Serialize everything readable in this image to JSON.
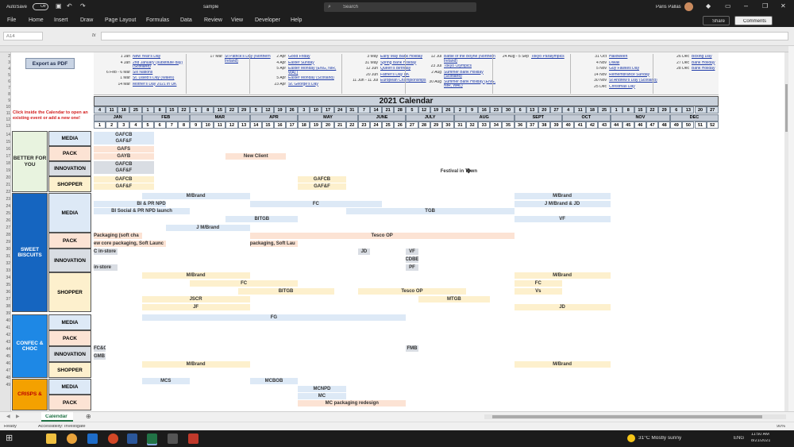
{
  "titlebar": {
    "autosave": "AutoSave",
    "autosave_state": "Off",
    "filename": "sample",
    "search": "Search",
    "user": "Paris Pallas"
  },
  "ribbon": {
    "tabs": [
      "File",
      "Home",
      "Insert",
      "Draw",
      "Page Layout",
      "Formulas",
      "Data",
      "Review",
      "View",
      "Developer",
      "Help"
    ],
    "share": "Share",
    "comments": "Comments"
  },
  "formula_bar": {
    "name_box": "A14",
    "fx": "fx"
  },
  "export_button": "Export as PDF",
  "instruction": "Click inside the Calendar to open an existing event or add a new one!",
  "holidays": {
    "col1": [
      [
        "1 Jan",
        "New Year's Day"
      ],
      [
        "4 Jan",
        "2nd January (substitute day) (Scotland)"
      ],
      [
        "6 Feb - 6 Mar",
        "Six Nations"
      ],
      [
        "1 Mar",
        "St. David's Day (Wales)"
      ],
      [
        "14 Mar",
        "Mother's Day 2021 in UK"
      ]
    ],
    "col2": [
      [
        "17 Mar",
        "St Patrick's Day (Northern Ireland)"
      ]
    ],
    "col3": [
      [
        "2 Apr",
        "Good Friday"
      ],
      [
        "4 Apr",
        "Easter Sunday"
      ],
      [
        "5 Apr",
        "Easter Monday (ENG, NIR, WAL)"
      ],
      [
        "5 Apr",
        "Easter Monday (Scotland)"
      ],
      [
        "23 Apr",
        "St. George's Day"
      ]
    ],
    "col4": [
      [
        "3 May",
        "Early May Bank Holiday"
      ],
      [
        "31 May",
        "Spring Bank Holiday"
      ],
      [
        "12 Jun",
        "Queen's Birthday"
      ],
      [
        "20 Jun",
        "Father's Day UK"
      ],
      [
        "11 Jun - 11 Jul",
        "European Championships"
      ]
    ],
    "col5": [
      [
        "12 Jul",
        "Battle of the Boyne (Northern Ireland)"
      ],
      [
        "23 Jul",
        "Tokyo Olympics"
      ],
      [
        "2 Aug",
        "Summer Bank Holiday (Scotland)"
      ],
      [
        "30 Aug",
        "Summer Bank Holiday (ENG, NIR, WAL)"
      ]
    ],
    "col6": [
      [
        "24 Aug - 5 Sep",
        "Tokyo Paralympics"
      ]
    ],
    "col7": [
      [
        "31 Oct",
        "Halloween"
      ],
      [
        "4 Nov",
        "Diwali"
      ],
      [
        "5 Nov",
        "Guy Fawkes Day"
      ],
      [
        "14 Nov",
        "Remembrance Sunday"
      ],
      [
        "30 Nov",
        "St Andrew's Day (Scotland)"
      ],
      [
        "25 Dec",
        "Christmas Day"
      ]
    ],
    "col8": [
      [
        "26 Dec",
        "Boxing Day"
      ],
      [
        "27 Dec",
        "Bank Holiday"
      ],
      [
        "28 Dec",
        "Bank Holiday"
      ]
    ]
  },
  "calendar": {
    "title": "2021 Calendar",
    "week_days": [
      "4",
      "11",
      "18",
      "25",
      "1",
      "8",
      "15",
      "22",
      "1",
      "8",
      "15",
      "22",
      "29",
      "5",
      "12",
      "19",
      "26",
      "3",
      "10",
      "17",
      "24",
      "31",
      "7",
      "14",
      "21",
      "28",
      "5",
      "12",
      "19",
      "26",
      "2",
      "9",
      "16",
      "23",
      "30",
      "6",
      "13",
      "20",
      "27",
      "4",
      "11",
      "18",
      "25",
      "1",
      "8",
      "15",
      "22",
      "29",
      "6",
      "13",
      "20",
      "27"
    ],
    "months": [
      [
        "JAN",
        4
      ],
      [
        "FEB",
        4
      ],
      [
        "MAR",
        5
      ],
      [
        "APR",
        4
      ],
      [
        "MAY",
        5
      ],
      [
        "JUNE",
        4
      ],
      [
        "JULY",
        4
      ],
      [
        "AUG",
        5
      ],
      [
        "SEPT",
        4
      ],
      [
        "OCT",
        4
      ],
      [
        "NOV",
        5
      ],
      [
        "DEC",
        4
      ]
    ],
    "week_numbers": [
      "1",
      "2",
      "3",
      "4",
      "5",
      "6",
      "7",
      "8",
      "9",
      "10",
      "11",
      "12",
      "13",
      "14",
      "15",
      "16",
      "17",
      "18",
      "19",
      "20",
      "21",
      "22",
      "23",
      "24",
      "25",
      "26",
      "27",
      "28",
      "29",
      "30",
      "31",
      "32",
      "33",
      "34",
      "35",
      "36",
      "37",
      "38",
      "39",
      "40",
      "41",
      "42",
      "43",
      "44",
      "45",
      "46",
      "47",
      "48",
      "49",
      "50",
      "51",
      "52"
    ]
  },
  "categories": [
    {
      "name": "BETTER FOR YOU",
      "color": "#e8f3df",
      "subs": [
        "MEDIA",
        "PACK",
        "INNOVATION",
        "SHOPPER"
      ]
    },
    {
      "name": "SWEET BISCUITS",
      "color": "#1565c0",
      "subs": [
        "MEDIA",
        "PACK",
        "INNOVATION",
        "SHOPPER"
      ]
    },
    {
      "name": "CONFEC & CHOC",
      "color": "#1e88e5",
      "subs": [
        "MEDIA",
        "PACK",
        "INNOVATION",
        "SHOPPER"
      ]
    },
    {
      "name": "CRISPS &",
      "color": "#f4a100",
      "subs": [
        "MEDIA",
        "PACK"
      ]
    }
  ],
  "events": {
    "gafcb1": "GAFCB",
    "gaff1": "GAF&F",
    "gafs": "GAFS",
    "gayb": "GAYB",
    "gafcb2": "GAFCB",
    "gaff2": "GAF&F",
    "gafcb3": "GAFCB",
    "gaff3": "GAF&F",
    "newclient": "New Client",
    "gafcb4": "GAFCB",
    "gaff4": "GAF&F",
    "festival": "Festival in Town",
    "mbrand1": "M/Brand",
    "prnpd": "BI & PR NPD",
    "fc1": "FC",
    "bisocial": "BI Social & PR NPD launch",
    "tgb": "TGB",
    "bitgb1": "BITGB",
    "mbrand2": "M/Brand",
    "mbrandjd": "J M/Brand & JD",
    "vf1": "VF",
    "jmbrand": "J M/Brand",
    "pack1": "Packaging (soft cha",
    "pack2": "ew core packaging, Soft Launc",
    "pack3": "packaging, Soft Lau",
    "tescoop1": "Tesco OP",
    "instore1": "C in-store",
    "jd1": "JD",
    "vf2": "VF",
    "cdbe": "CDBE",
    "instore2": "in-store",
    "pf": "PF",
    "mbrand3": "M/Brand",
    "mbrand4": "M/Brand",
    "fc2": "FC",
    "fc3": "FC",
    "bitgb2": "BITGB",
    "tescoop2": "Tesco OP",
    "vs": "Vs",
    "jscr": "JSCR",
    "mtgb": "MTGB",
    "jf": "JF",
    "jd2": "JD",
    "fg": "FG",
    "fcc": "FC&C",
    "gmb": "GMB",
    "fmb": "FMB",
    "mbrand5": "M/Brand",
    "mbrand6": "M/Brand",
    "mcs": "MCS",
    "mcbob": "MCBOB",
    "mcnpd": "MCNPD",
    "mc": "MC",
    "mcpack": "MC packaging redesign"
  },
  "sheet_tab": "Calendar",
  "status": {
    "ready": "Ready",
    "accessibility": "Accessibility: Investigate",
    "zoom": "90%"
  },
  "taskbar": {
    "weather": "31°C  Mostly sunny",
    "lang": "ENG",
    "time": "11:50 AM",
    "date": "8/21/2021"
  },
  "colors": {
    "media": "#dde9f6",
    "pack": "#fce3d4",
    "innovation": "#d9dde3",
    "shopper": "#fdf0cd",
    "header": "#c5ccd6"
  }
}
